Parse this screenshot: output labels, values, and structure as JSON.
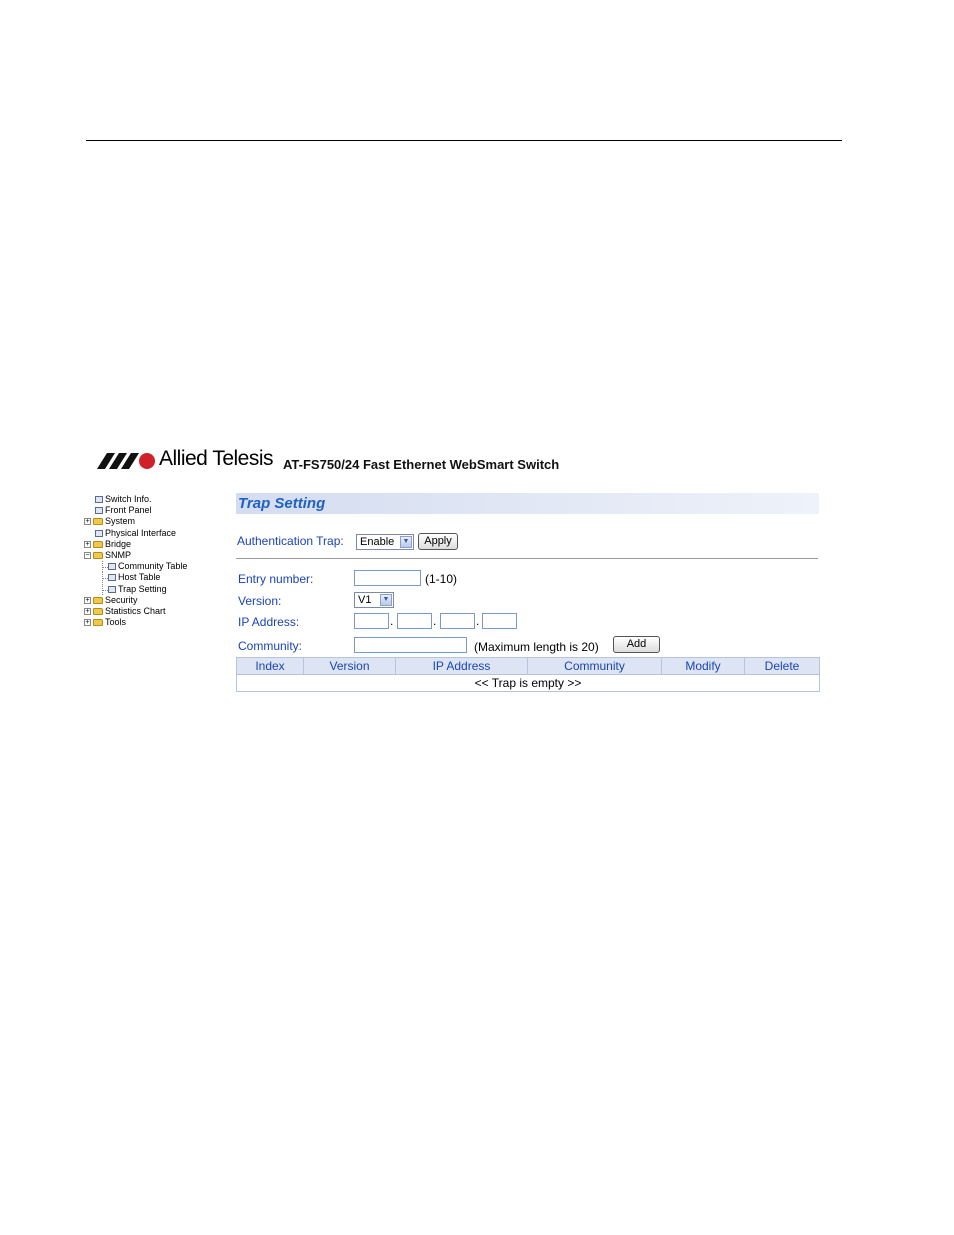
{
  "header": {
    "brand": "Allied Telesis",
    "product": "AT-FS750/24 Fast Ethernet WebSmart Switch"
  },
  "tree": {
    "items": [
      {
        "label": "Switch Info.",
        "type": "page",
        "expander": "",
        "level": 0
      },
      {
        "label": "Front Panel",
        "type": "page",
        "expander": "",
        "level": 0
      },
      {
        "label": "System",
        "type": "folder",
        "expander": "+",
        "level": 0
      },
      {
        "label": "Physical Interface",
        "type": "page",
        "expander": "",
        "level": 0
      },
      {
        "label": "Bridge",
        "type": "folder",
        "expander": "+",
        "level": 0
      },
      {
        "label": "SNMP",
        "type": "folder",
        "expander": "−",
        "level": 0
      },
      {
        "label": "Community Table",
        "type": "page",
        "expander": "",
        "level": 1
      },
      {
        "label": "Host Table",
        "type": "page",
        "expander": "",
        "level": 1
      },
      {
        "label": "Trap Setting",
        "type": "page",
        "expander": "",
        "level": 1
      },
      {
        "label": "Security",
        "type": "folder",
        "expander": "+",
        "level": 0
      },
      {
        "label": "Statistics Chart",
        "type": "folder",
        "expander": "+",
        "level": 0
      },
      {
        "label": "Tools",
        "type": "folder",
        "expander": "+",
        "level": 0
      }
    ]
  },
  "panel": {
    "title": "Trap Setting",
    "auth_trap_label": "Authentication Trap:",
    "auth_trap_value": "Enable",
    "apply_label": "Apply",
    "entry_label": "Entry number:",
    "entry_hint": "(1-10)",
    "version_label": "Version:",
    "version_value": "V1",
    "ip_label": "IP Address:",
    "community_label": "Community:",
    "community_hint": "(Maximum length is 20)",
    "add_label": "Add"
  },
  "table": {
    "headers": [
      "Index",
      "Version",
      "IP Address",
      "Community",
      "Modify",
      "Delete"
    ],
    "empty_message": "<< Trap is empty >>"
  },
  "colors": {
    "label_blue": "#1a44b6",
    "title_blue": "#1d62c2",
    "header_bg": "#dde5f4"
  }
}
